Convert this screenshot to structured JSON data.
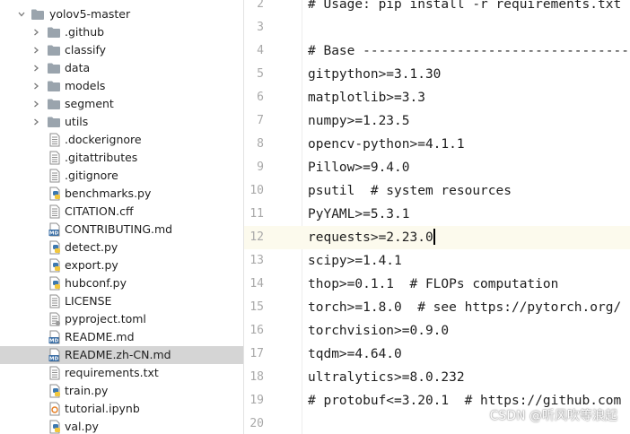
{
  "colors": {
    "folder": "#9aa4ad",
    "arrow": "#7a7a7a",
    "line_number": "#a9a9a9",
    "current_line_bg": "#fcfaed",
    "selection_bg": "#d5d5d5",
    "python_icon_blue": "#3d79b0",
    "python_icon_yellow": "#f2c73d",
    "md_badge": "#3a6ea5"
  },
  "tree": {
    "root": {
      "label": "yolov5-master",
      "icon": "folder-icon",
      "expanded": true
    },
    "folders": [
      {
        "label": ".github",
        "icon": "folder-icon"
      },
      {
        "label": "classify",
        "icon": "folder-icon"
      },
      {
        "label": "data",
        "icon": "folder-icon"
      },
      {
        "label": "models",
        "icon": "folder-icon"
      },
      {
        "label": "segment",
        "icon": "folder-icon"
      },
      {
        "label": "utils",
        "icon": "folder-icon"
      }
    ],
    "files": [
      {
        "label": ".dockerignore",
        "icon": "text-file-icon"
      },
      {
        "label": ".gitattributes",
        "icon": "text-file-icon"
      },
      {
        "label": ".gitignore",
        "icon": "text-file-icon"
      },
      {
        "label": "benchmarks.py",
        "icon": "python-file-icon"
      },
      {
        "label": "CITATION.cff",
        "icon": "text-file-icon"
      },
      {
        "label": "CONTRIBUTING.md",
        "icon": "markdown-file-icon"
      },
      {
        "label": "detect.py",
        "icon": "python-file-icon"
      },
      {
        "label": "export.py",
        "icon": "python-file-icon"
      },
      {
        "label": "hubconf.py",
        "icon": "python-file-icon"
      },
      {
        "label": "LICENSE",
        "icon": "text-file-icon"
      },
      {
        "label": "pyproject.toml",
        "icon": "toml-file-icon"
      },
      {
        "label": "README.md",
        "icon": "markdown-file-icon"
      },
      {
        "label": "README.zh-CN.md",
        "icon": "markdown-file-icon",
        "selected": true
      },
      {
        "label": "requirements.txt",
        "icon": "text-file-icon"
      },
      {
        "label": "train.py",
        "icon": "python-file-icon"
      },
      {
        "label": "tutorial.ipynb",
        "icon": "notebook-file-icon"
      },
      {
        "label": "val.py",
        "icon": "python-file-icon"
      }
    ]
  },
  "editor": {
    "current_line": 12,
    "lines": [
      {
        "number": "2",
        "text": "# Usage: pip install -r requirements.txt"
      },
      {
        "number": "3",
        "text": ""
      },
      {
        "number": "4",
        "text": "# Base ------------------------------------"
      },
      {
        "number": "5",
        "text": "gitpython>=3.1.30"
      },
      {
        "number": "6",
        "text": "matplotlib>=3.3"
      },
      {
        "number": "7",
        "text": "numpy>=1.23.5"
      },
      {
        "number": "8",
        "text": "opencv-python>=4.1.1"
      },
      {
        "number": "9",
        "text": "Pillow>=9.4.0"
      },
      {
        "number": "10",
        "text": "psutil  # system resources"
      },
      {
        "number": "11",
        "text": "PyYAML>=5.3.1"
      },
      {
        "number": "12",
        "text": "requests>=2.23.0"
      },
      {
        "number": "13",
        "text": "scipy>=1.4.1"
      },
      {
        "number": "14",
        "text": "thop>=0.1.1  # FLOPs computation"
      },
      {
        "number": "15",
        "text": "torch>=1.8.0  # see https://pytorch.org/"
      },
      {
        "number": "16",
        "text": "torchvision>=0.9.0"
      },
      {
        "number": "17",
        "text": "tqdm>=4.64.0"
      },
      {
        "number": "18",
        "text": "ultralytics>=8.0.232"
      },
      {
        "number": "19",
        "text": "# protobuf<=3.20.1  # https://github.com"
      },
      {
        "number": "20",
        "text": ""
      }
    ]
  },
  "watermark": "CSDN @听风吹等浪起"
}
